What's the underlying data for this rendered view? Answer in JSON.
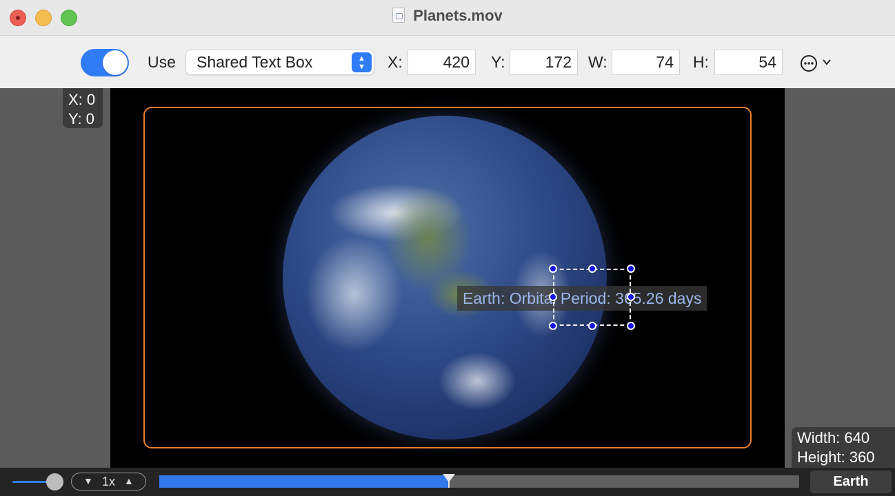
{
  "window": {
    "title": "Planets.mov"
  },
  "toolbar": {
    "toggle_on": true,
    "use_label": "Use",
    "selected_style": "Shared Text Box",
    "x_label": "X:",
    "x_value": "420",
    "y_label": "Y:",
    "y_value": "172",
    "w_label": "W:",
    "w_value": "74",
    "h_label": "H:",
    "h_value": "54",
    "more_icon": "ellipsis-circle-icon"
  },
  "cursor_badge": {
    "x": "X: 0",
    "y": "Y: 0"
  },
  "video": {
    "caption": "Earth: Orbital Period: 365.26 days",
    "frame_color": "#e8802a"
  },
  "size_badge": {
    "width": "Width: 640",
    "height": "Height: 360"
  },
  "playback": {
    "rate_label": "1x",
    "volume": 0.8,
    "progress": 0.453,
    "chapter": "Earth",
    "accent": "#3479ec"
  }
}
